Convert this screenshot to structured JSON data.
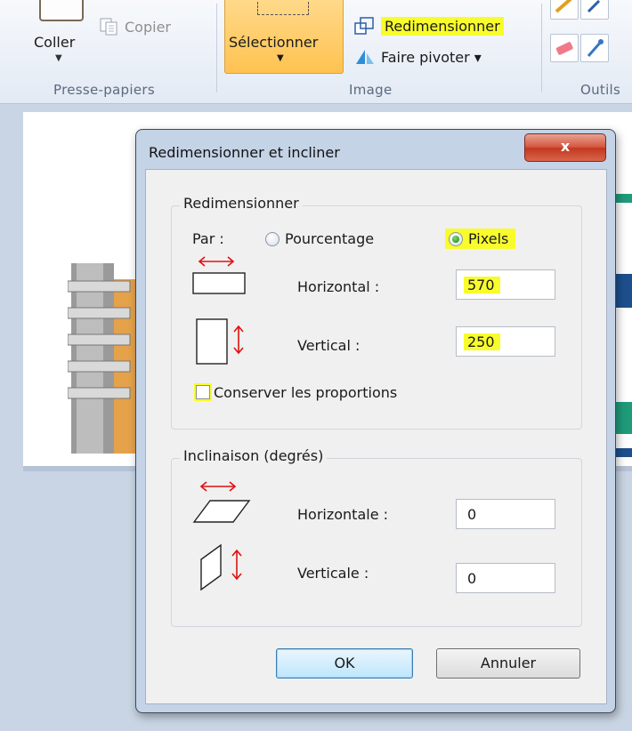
{
  "ribbon": {
    "clipboard": {
      "paste_label": "Coller",
      "copy_label": "Copier",
      "group_label": "Presse-papiers"
    },
    "image": {
      "select_label": "Sélectionner",
      "resize_label": "Redimensionner",
      "rotate_label": "Faire pivoter ▾",
      "group_label": "Image"
    },
    "tools": {
      "group_label": "Outils"
    }
  },
  "dialog": {
    "title": "Redimensionner et incliner",
    "close_label": "x",
    "resize_group": {
      "title": "Redimensionner",
      "by_label": "Par :",
      "options": [
        "Pourcentage",
        "Pixels"
      ],
      "selected": "Pixels",
      "horizontal_label": "Horizontal :",
      "horizontal_value": "570",
      "vertical_label": "Vertical :",
      "vertical_value": "250",
      "keep_ratio_label": "Conserver les proportions",
      "keep_ratio_checked": false
    },
    "skew_group": {
      "title": "Inclinaison (degrés)",
      "horizontal_label": "Horizontale :",
      "horizontal_value": "0",
      "vertical_label": "Verticale :",
      "vertical_value": "0"
    },
    "ok_label": "OK",
    "cancel_label": "Annuler"
  },
  "colors": {
    "highlight": "#f8fc2c",
    "select_button": "#ffc251",
    "arrow_red": "#e01010"
  },
  "icons": {
    "paste": "clipboard-icon",
    "copy": "copy-icon",
    "resize": "resize-icon",
    "rotate": "rotate-icon",
    "eraser": "eraser-icon",
    "color_picker": "color-picker-icon",
    "pencil": "pencil-icon"
  }
}
